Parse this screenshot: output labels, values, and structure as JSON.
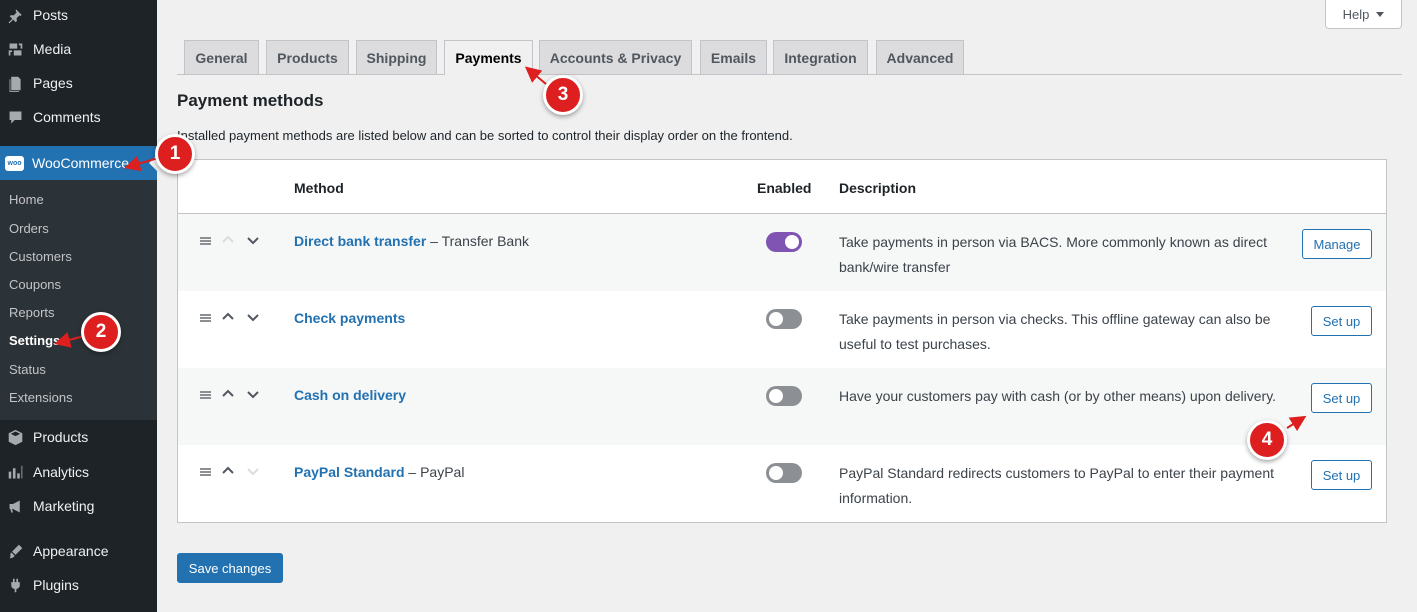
{
  "sidebar": {
    "top_items": [
      {
        "label": "Posts",
        "icon": "pushpin-icon"
      },
      {
        "label": "Media",
        "icon": "media-icon"
      },
      {
        "label": "Pages",
        "icon": "pages-icon"
      },
      {
        "label": "Comments",
        "icon": "comments-icon"
      }
    ],
    "woocommerce": {
      "label": "WooCommerce",
      "icon": "woo-icon",
      "icon_text": "woo"
    },
    "submenu": [
      "Home",
      "Orders",
      "Customers",
      "Coupons",
      "Reports",
      "Settings",
      "Status",
      "Extensions"
    ],
    "current_submenu": "Settings",
    "bottom_items": [
      {
        "label": "Products",
        "icon": "products-icon"
      },
      {
        "label": "Analytics",
        "icon": "analytics-icon"
      },
      {
        "label": "Marketing",
        "icon": "marketing-icon"
      },
      {
        "label": "Appearance",
        "icon": "appearance-icon"
      },
      {
        "label": "Plugins",
        "icon": "plugins-icon"
      }
    ]
  },
  "help": {
    "label": "Help"
  },
  "tabs": [
    {
      "label": "General"
    },
    {
      "label": "Products"
    },
    {
      "label": "Shipping"
    },
    {
      "label": "Payments",
      "active": true
    },
    {
      "label": "Accounts & Privacy"
    },
    {
      "label": "Emails"
    },
    {
      "label": "Integration"
    },
    {
      "label": "Advanced"
    }
  ],
  "page": {
    "title": "Payment methods",
    "description": "Installed payment methods are listed below and can be sorted to control their display order on the frontend."
  },
  "table": {
    "headers": {
      "method": "Method",
      "enabled": "Enabled",
      "description": "Description"
    },
    "rows": [
      {
        "name": "Direct bank transfer",
        "subtitle": "– Transfer Bank",
        "enabled": true,
        "description": "Take payments in person via BACS. More commonly known as direct bank/wire transfer",
        "action": "Manage",
        "up_enabled": false,
        "down_enabled": true
      },
      {
        "name": "Check payments",
        "subtitle": "",
        "enabled": false,
        "description": "Take payments in person via checks. This offline gateway can also be useful to test purchases.",
        "action": "Set up",
        "up_enabled": true,
        "down_enabled": true
      },
      {
        "name": "Cash on delivery",
        "subtitle": "",
        "enabled": false,
        "description": "Have your customers pay with cash (or by other means) upon delivery.",
        "action": "Set up",
        "up_enabled": true,
        "down_enabled": true
      },
      {
        "name": "PayPal Standard",
        "subtitle": "– PayPal",
        "enabled": false,
        "description": "PayPal Standard redirects customers to PayPal to enter their payment information.",
        "action": "Set up",
        "up_enabled": true,
        "down_enabled": false
      }
    ]
  },
  "save": {
    "label": "Save changes"
  },
  "annotations": [
    "1",
    "2",
    "3",
    "4"
  ],
  "colors": {
    "sidebar_bg": "#1d2327",
    "submenu_bg": "#2c3338",
    "accent": "#2271b1",
    "toggle_on": "#7f54b3",
    "badge": "#dd1f1f"
  }
}
